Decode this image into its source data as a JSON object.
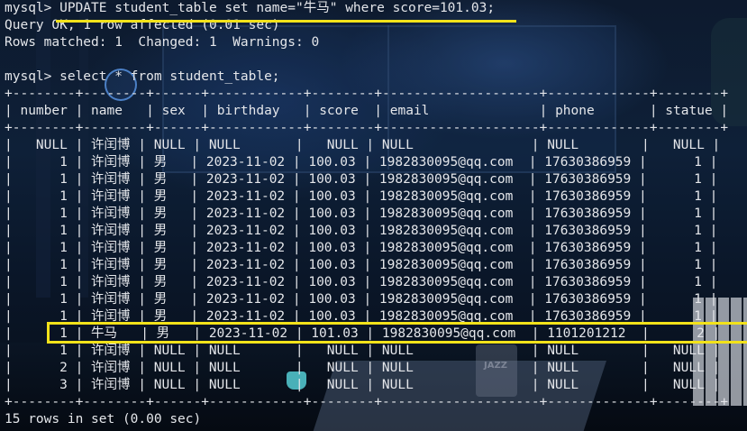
{
  "terminal": {
    "lines": [
      "mysql> UPDATE student_table set name=\"牛马\" where score=101.03;",
      "Query OK, 1 row affected (0.01 sec)",
      "Rows matched: 1  Changed: 1  Warnings: 0",
      "",
      "mysql> select * from student_table;",
      "+--------+--------+------+------------+--------+--------------------+-------------+--------+",
      "| number | name   | sex  | birthday   | score  | email              | phone       | statue |",
      "+--------+--------+------+------------+--------+--------------------+-------------+--------+",
      "|   NULL | 许闰博 | NULL | NULL       |   NULL | NULL               | NULL        |   NULL |",
      "|      1 | 许闰博 | 男   | 2023-11-02 | 100.03 | 1982830095@qq.com  | 17630386959 |      1 |",
      "|      1 | 许闰博 | 男   | 2023-11-02 | 100.03 | 1982830095@qq.com  | 17630386959 |      1 |",
      "|      1 | 许闰博 | 男   | 2023-11-02 | 100.03 | 1982830095@qq.com  | 17630386959 |      1 |",
      "|      1 | 许闰博 | 男   | 2023-11-02 | 100.03 | 1982830095@qq.com  | 17630386959 |      1 |",
      "|      1 | 许闰博 | 男   | 2023-11-02 | 100.03 | 1982830095@qq.com  | 17630386959 |      1 |",
      "|      1 | 许闰博 | 男   | 2023-11-02 | 100.03 | 1982830095@qq.com  | 17630386959 |      1 |",
      "|      1 | 许闰博 | 男   | 2023-11-02 | 100.03 | 1982830095@qq.com  | 17630386959 |      1 |",
      "|      1 | 许闰博 | 男   | 2023-11-02 | 100.03 | 1982830095@qq.com  | 17630386959 |      1 |",
      "|      1 | 许闰博 | 男   | 2023-11-02 | 100.03 | 1982830095@qq.com  | 17630386959 |      1 |",
      "|      1 | 许闰博 | 男   | 2023-11-02 | 100.03 | 1982830095@qq.com  | 17630386959 |      1 |",
      "|      1 | 牛马   | 男   | 2023-11-02 | 101.03 | 1982830095@qq.com  | 1101201212  |      2 |",
      "|      1 | 许闰博 | NULL | NULL       |   NULL | NULL               | NULL        |   NULL |",
      "|      2 | 许闰博 | NULL | NULL       |   NULL | NULL               | NULL        |   NULL |",
      "|      3 | 许闰博 | NULL | NULL       |   NULL | NULL               | NULL        |   NULL |",
      "+--------+--------+------+------------+--------+--------------------+-------------+--------+",
      "15 rows in set (0.00 sec)"
    ],
    "background_text": "JAZZ"
  },
  "colors": {
    "text": "#e4e6ea",
    "highlight": "#f2e21a",
    "background": "#0b1422"
  }
}
